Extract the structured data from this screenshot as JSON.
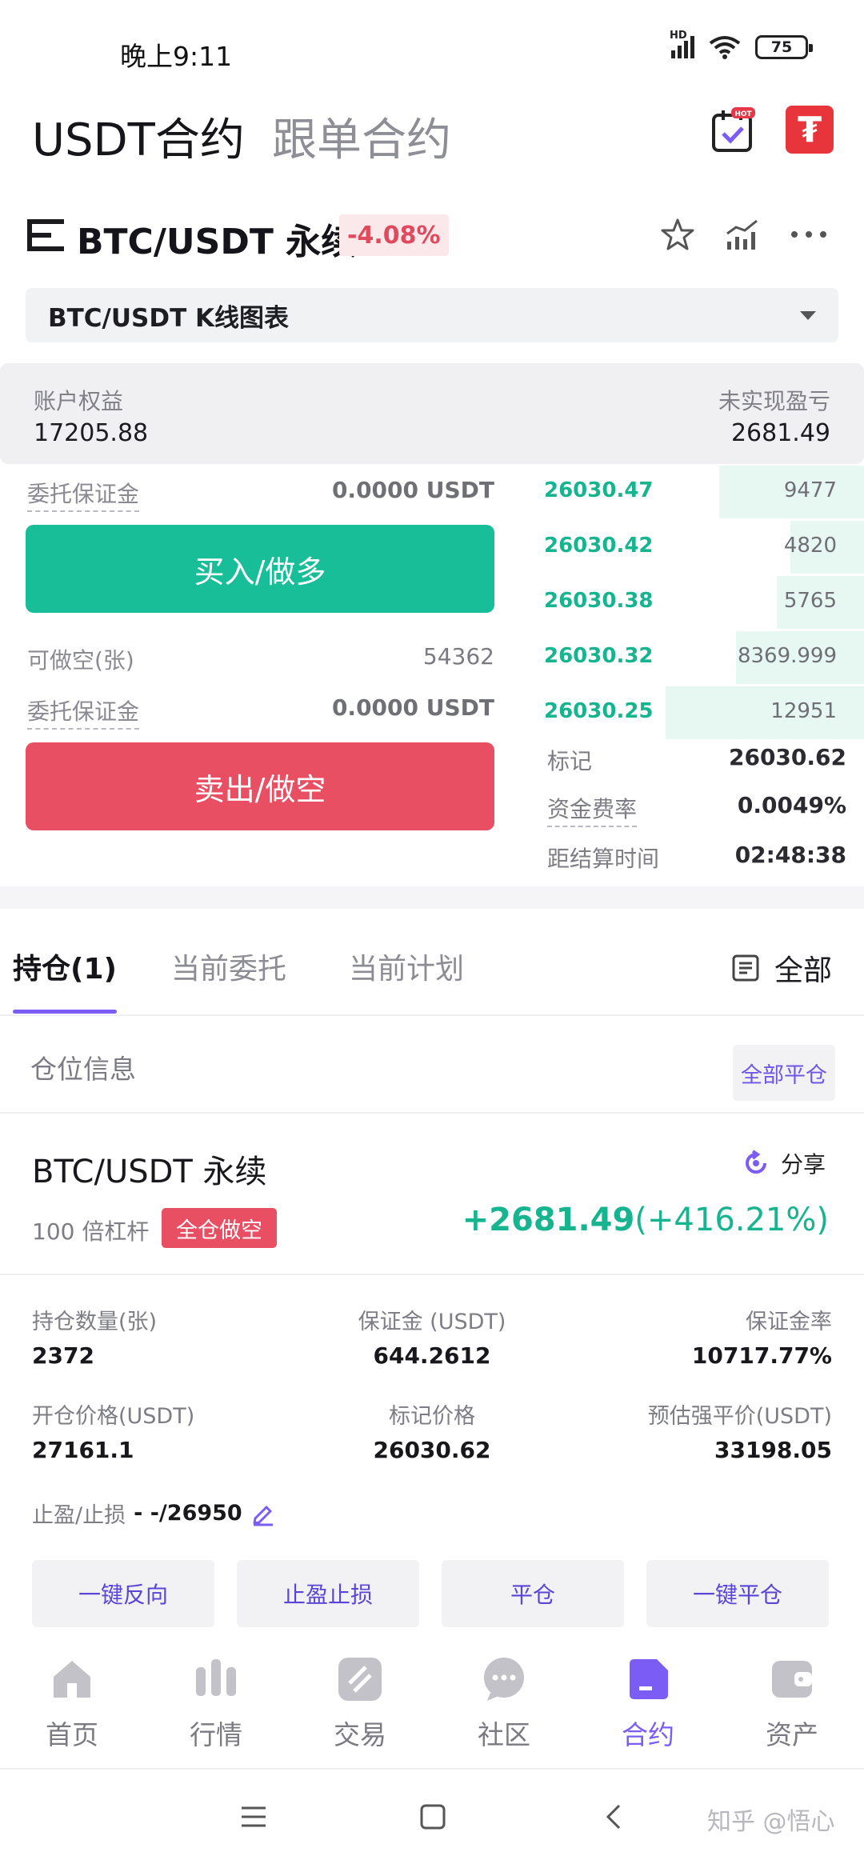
{
  "status_bar": {
    "time": "晚上9:11",
    "network": "HD",
    "battery": "75"
  },
  "top_tabs": {
    "active": "USDT合约",
    "inactive": "跟单合约",
    "hot_badge": "HOT"
  },
  "pair": {
    "name": "BTC/USDT 永续",
    "change": "-4.08%"
  },
  "kline_selector": {
    "label": "BTC/USDT K线图表"
  },
  "account": {
    "equity_label": "账户权益",
    "equity_value": "17205.88",
    "unrealized_label": "未实现盈亏",
    "unrealized_value": "2681.49"
  },
  "order_panel": {
    "buy_margin_label": "委托保证金",
    "buy_margin_value": "0.0000 USDT",
    "buy_button": "买入/做多",
    "short_avail_label": "可做空(张)",
    "short_avail_value": "54362",
    "sell_margin_label": "委托保证金",
    "sell_margin_value": "0.0000 USDT",
    "sell_button": "卖出/做空"
  },
  "order_book": {
    "bids": [
      {
        "price": "26030.47",
        "qty": "9477",
        "depth": 0.43
      },
      {
        "price": "26030.42",
        "qty": "4820",
        "depth": 0.22
      },
      {
        "price": "26030.38",
        "qty": "5765",
        "depth": 0.26
      },
      {
        "price": "26030.32",
        "qty": "8369.999",
        "depth": 0.38
      },
      {
        "price": "26030.25",
        "qty": "12951",
        "depth": 0.59
      }
    ],
    "mark_label": "标记",
    "mark_value": "26030.62",
    "funding_label": "资金费率",
    "funding_value": "0.0049%",
    "settle_label": "距结算时间",
    "settle_value": "02:48:38"
  },
  "position_tabs": {
    "holding": "持仓(1)",
    "orders": "当前委托",
    "plans": "当前计划",
    "all": "全部"
  },
  "position_section": {
    "title": "仓位信息",
    "close_all": "全部平仓"
  },
  "position": {
    "title": "BTC/USDT 永续",
    "share": "分享",
    "leverage": "100 倍杠杆",
    "mode_badge": "全仓做空",
    "pnl": "+2681.49",
    "pnl_pct": "(+416.21%)",
    "stats": {
      "qty_label": "持仓数量(张)",
      "qty_value": "2372",
      "margin_label": "保证金 (USDT)",
      "margin_value": "644.2612",
      "margin_rate_label": "保证金率",
      "margin_rate_value": "10717.77%",
      "open_price_label": "开仓价格(USDT)",
      "open_price_value": "27161.1",
      "mark_price_label": "标记价格",
      "mark_price_value": "26030.62",
      "liq_label": "预估强平价(USDT)",
      "liq_value": "33198.05"
    },
    "tpsl_label": "止盈/止损",
    "tpsl_value": "- -/26950",
    "actions": [
      "一键反向",
      "止盈止损",
      "平仓",
      "一键平仓"
    ]
  },
  "bottom_nav": [
    "首页",
    "行情",
    "交易",
    "社区",
    "合约",
    "资产"
  ],
  "watermark": "知乎 @悟心",
  "colors": {
    "buy": "#17be98",
    "sell": "#e94f62",
    "accent": "#7b5cf5"
  }
}
